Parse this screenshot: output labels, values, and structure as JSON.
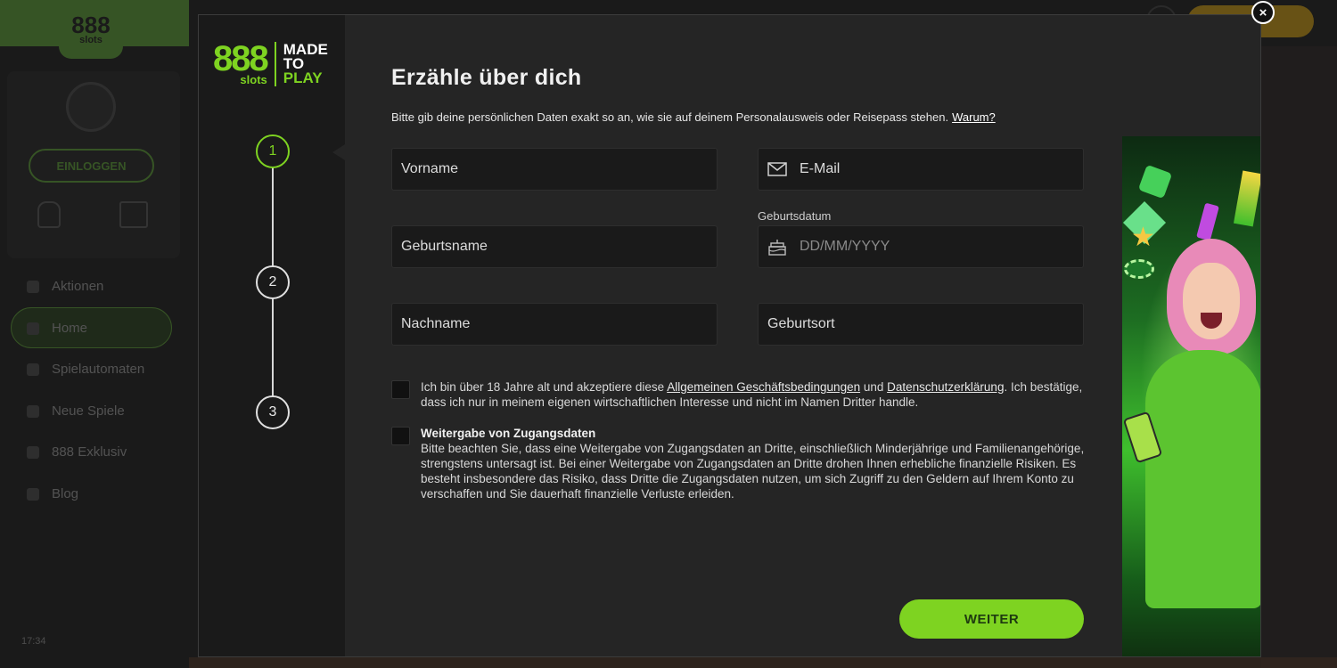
{
  "background": {
    "logo_number": "888",
    "logo_sub": "slots",
    "login_label": "EINLOGGEN",
    "nav": [
      "Aktionen",
      "Home",
      "Spielautomaten",
      "Neue Spiele",
      "888 Exklusiv",
      "Blog"
    ],
    "time": "17:34"
  },
  "modal": {
    "brand": {
      "number": "888",
      "sub": "slots",
      "tag_line1": "MADE",
      "tag_line2": "TO",
      "tag_line3": "PLAY"
    },
    "steps": [
      "1",
      "2",
      "3"
    ],
    "active_step": 1,
    "title": "Erzähle über dich",
    "subtitle": "Bitte gib deine persönlichen Daten exakt so an, wie sie auf deinem Personalausweis oder Reisepass stehen.",
    "subtitle_link": "Warum?",
    "fields": {
      "vorname": "Vorname",
      "email": "E-Mail",
      "geburtsdatum_label": "Geburtsdatum",
      "geburtsdatum_placeholder": "DD/MM/YYYY",
      "geburtsname": "Geburtsname",
      "nachname": "Nachname",
      "geburtsort": "Geburtsort"
    },
    "checkbox1": {
      "text_a": "Ich bin über 18 Jahre alt und akzeptiere diese ",
      "link_a": "Allgemeinen Geschäftsbedingungen",
      "text_b": " und ",
      "link_b": "Datenschutzerklärung",
      "text_c": ". Ich bestätige, dass ich nur in meinem eigenen wirtschaftlichen Interesse und nicht im Namen Dritter handle."
    },
    "checkbox2": {
      "heading": "Weitergabe von Zugangsdaten",
      "body": "Bitte beachten Sie, dass eine Weitergabe von Zugangsdaten an Dritte, einschließlich Minderjährige und Familienangehörige, strengstens untersagt ist. Bei einer Weitergabe von Zugangsdaten an Dritte drohen Ihnen erhebliche finanzielle Risiken. Es besteht insbesondere das Risiko, dass Dritte die Zugangsdaten nutzen, um sich Zugriff zu den Geldern auf Ihrem Konto zu verschaffen und Sie dauerhaft finanzielle Verluste erleiden."
    },
    "submit_label": "WEITER",
    "close_label": "×"
  },
  "colors": {
    "accent": "#7ed321",
    "modal_bg": "#252525",
    "field_bg": "#1a1a1a"
  },
  "icons": {
    "email": "envelope-icon",
    "birthday": "cake-icon",
    "close": "close-icon"
  }
}
